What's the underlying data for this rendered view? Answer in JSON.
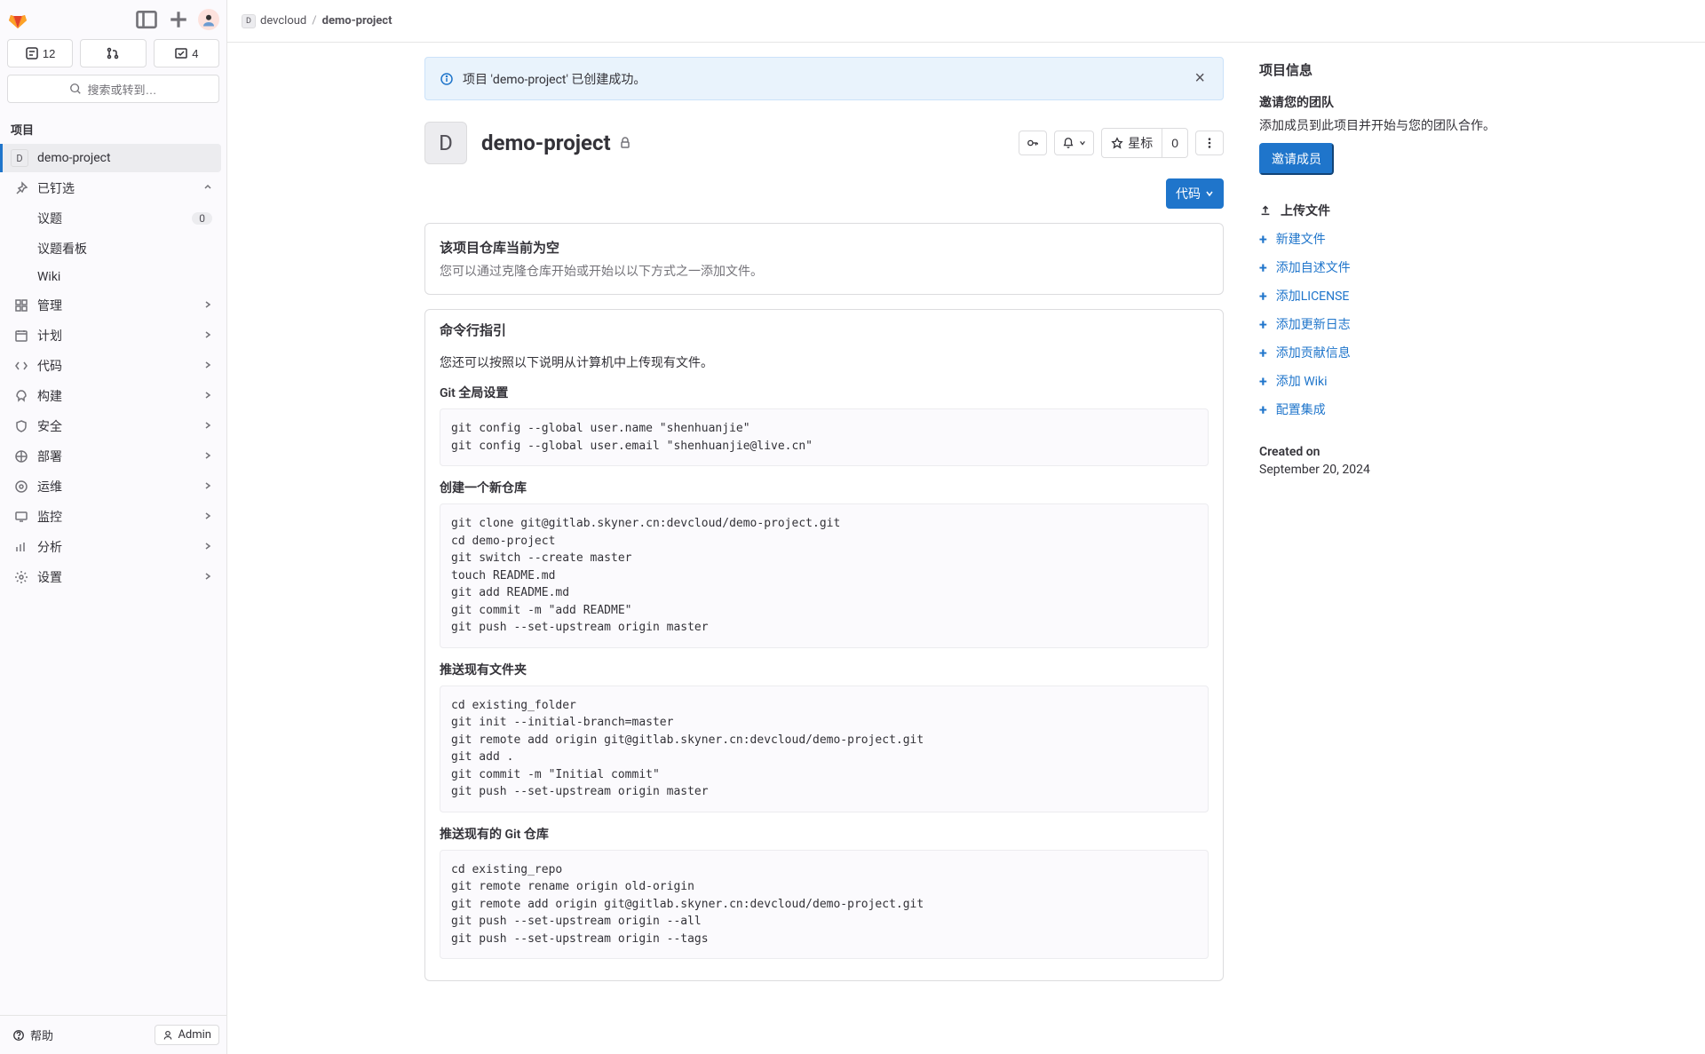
{
  "sidebar": {
    "stats": {
      "issues": "12",
      "todos": "4"
    },
    "search_placeholder": "搜索或转到…",
    "section_label": "项目",
    "project": {
      "letter": "D",
      "name": "demo-project"
    },
    "pinned": {
      "label": "已钉选",
      "items": [
        {
          "label": "议题",
          "badge": "0"
        },
        {
          "label": "议题看板"
        },
        {
          "label": "Wiki"
        }
      ]
    },
    "nav": [
      {
        "label": "管理"
      },
      {
        "label": "计划"
      },
      {
        "label": "代码"
      },
      {
        "label": "构建"
      },
      {
        "label": "安全"
      },
      {
        "label": "部署"
      },
      {
        "label": "运维"
      },
      {
        "label": "监控"
      },
      {
        "label": "分析"
      },
      {
        "label": "设置"
      }
    ],
    "help": "帮助",
    "admin": "Admin"
  },
  "breadcrumbs": {
    "group_icon": "D",
    "group": "devcloud",
    "project": "demo-project"
  },
  "alert_text": "项目 'demo-project' 已创建成功。",
  "project": {
    "avatar_letter": "D",
    "title": "demo-project",
    "star_label": "星标",
    "star_count": "0",
    "code_btn": "代码"
  },
  "repo_empty": {
    "title": "该项目仓库当前为空",
    "desc": "您可以通过克隆仓库开始或开始以以下方式之一添加文件。"
  },
  "cli": {
    "title": "命令行指引",
    "intro": "您还可以按照以下说明从计算机中上传现有文件。",
    "sec1_title": "Git 全局设置",
    "sec1_code": "git config --global user.name \"shenhuanjie\"\ngit config --global user.email \"shenhuanjie@live.cn\"",
    "sec2_title": "创建一个新仓库",
    "sec2_code": "git clone git@gitlab.skyner.cn:devcloud/demo-project.git\ncd demo-project\ngit switch --create master\ntouch README.md\ngit add README.md\ngit commit -m \"add README\"\ngit push --set-upstream origin master",
    "sec3_title": "推送现有文件夹",
    "sec3_code": "cd existing_folder\ngit init --initial-branch=master\ngit remote add origin git@gitlab.skyner.cn:devcloud/demo-project.git\ngit add .\ngit commit -m \"Initial commit\"\ngit push --set-upstream origin master",
    "sec4_title": "推送现有的 Git 仓库",
    "sec4_code": "cd existing_repo\ngit remote rename origin old-origin\ngit remote add origin git@gitlab.skyner.cn:devcloud/demo-project.git\ngit push --set-upstream origin --all\ngit push --set-upstream origin --tags"
  },
  "info": {
    "title": "项目信息",
    "team_title": "邀请您的团队",
    "team_desc": "添加成员到此项目并开始与您的团队合作。",
    "invite_btn": "邀请成员",
    "upload_label": "上传文件",
    "links": [
      "新建文件",
      "添加自述文件",
      "添加LICENSE",
      "添加更新日志",
      "添加贡献信息",
      "添加 Wiki",
      "配置集成"
    ],
    "created_label": "Created on",
    "created_date": "September 20, 2024"
  }
}
